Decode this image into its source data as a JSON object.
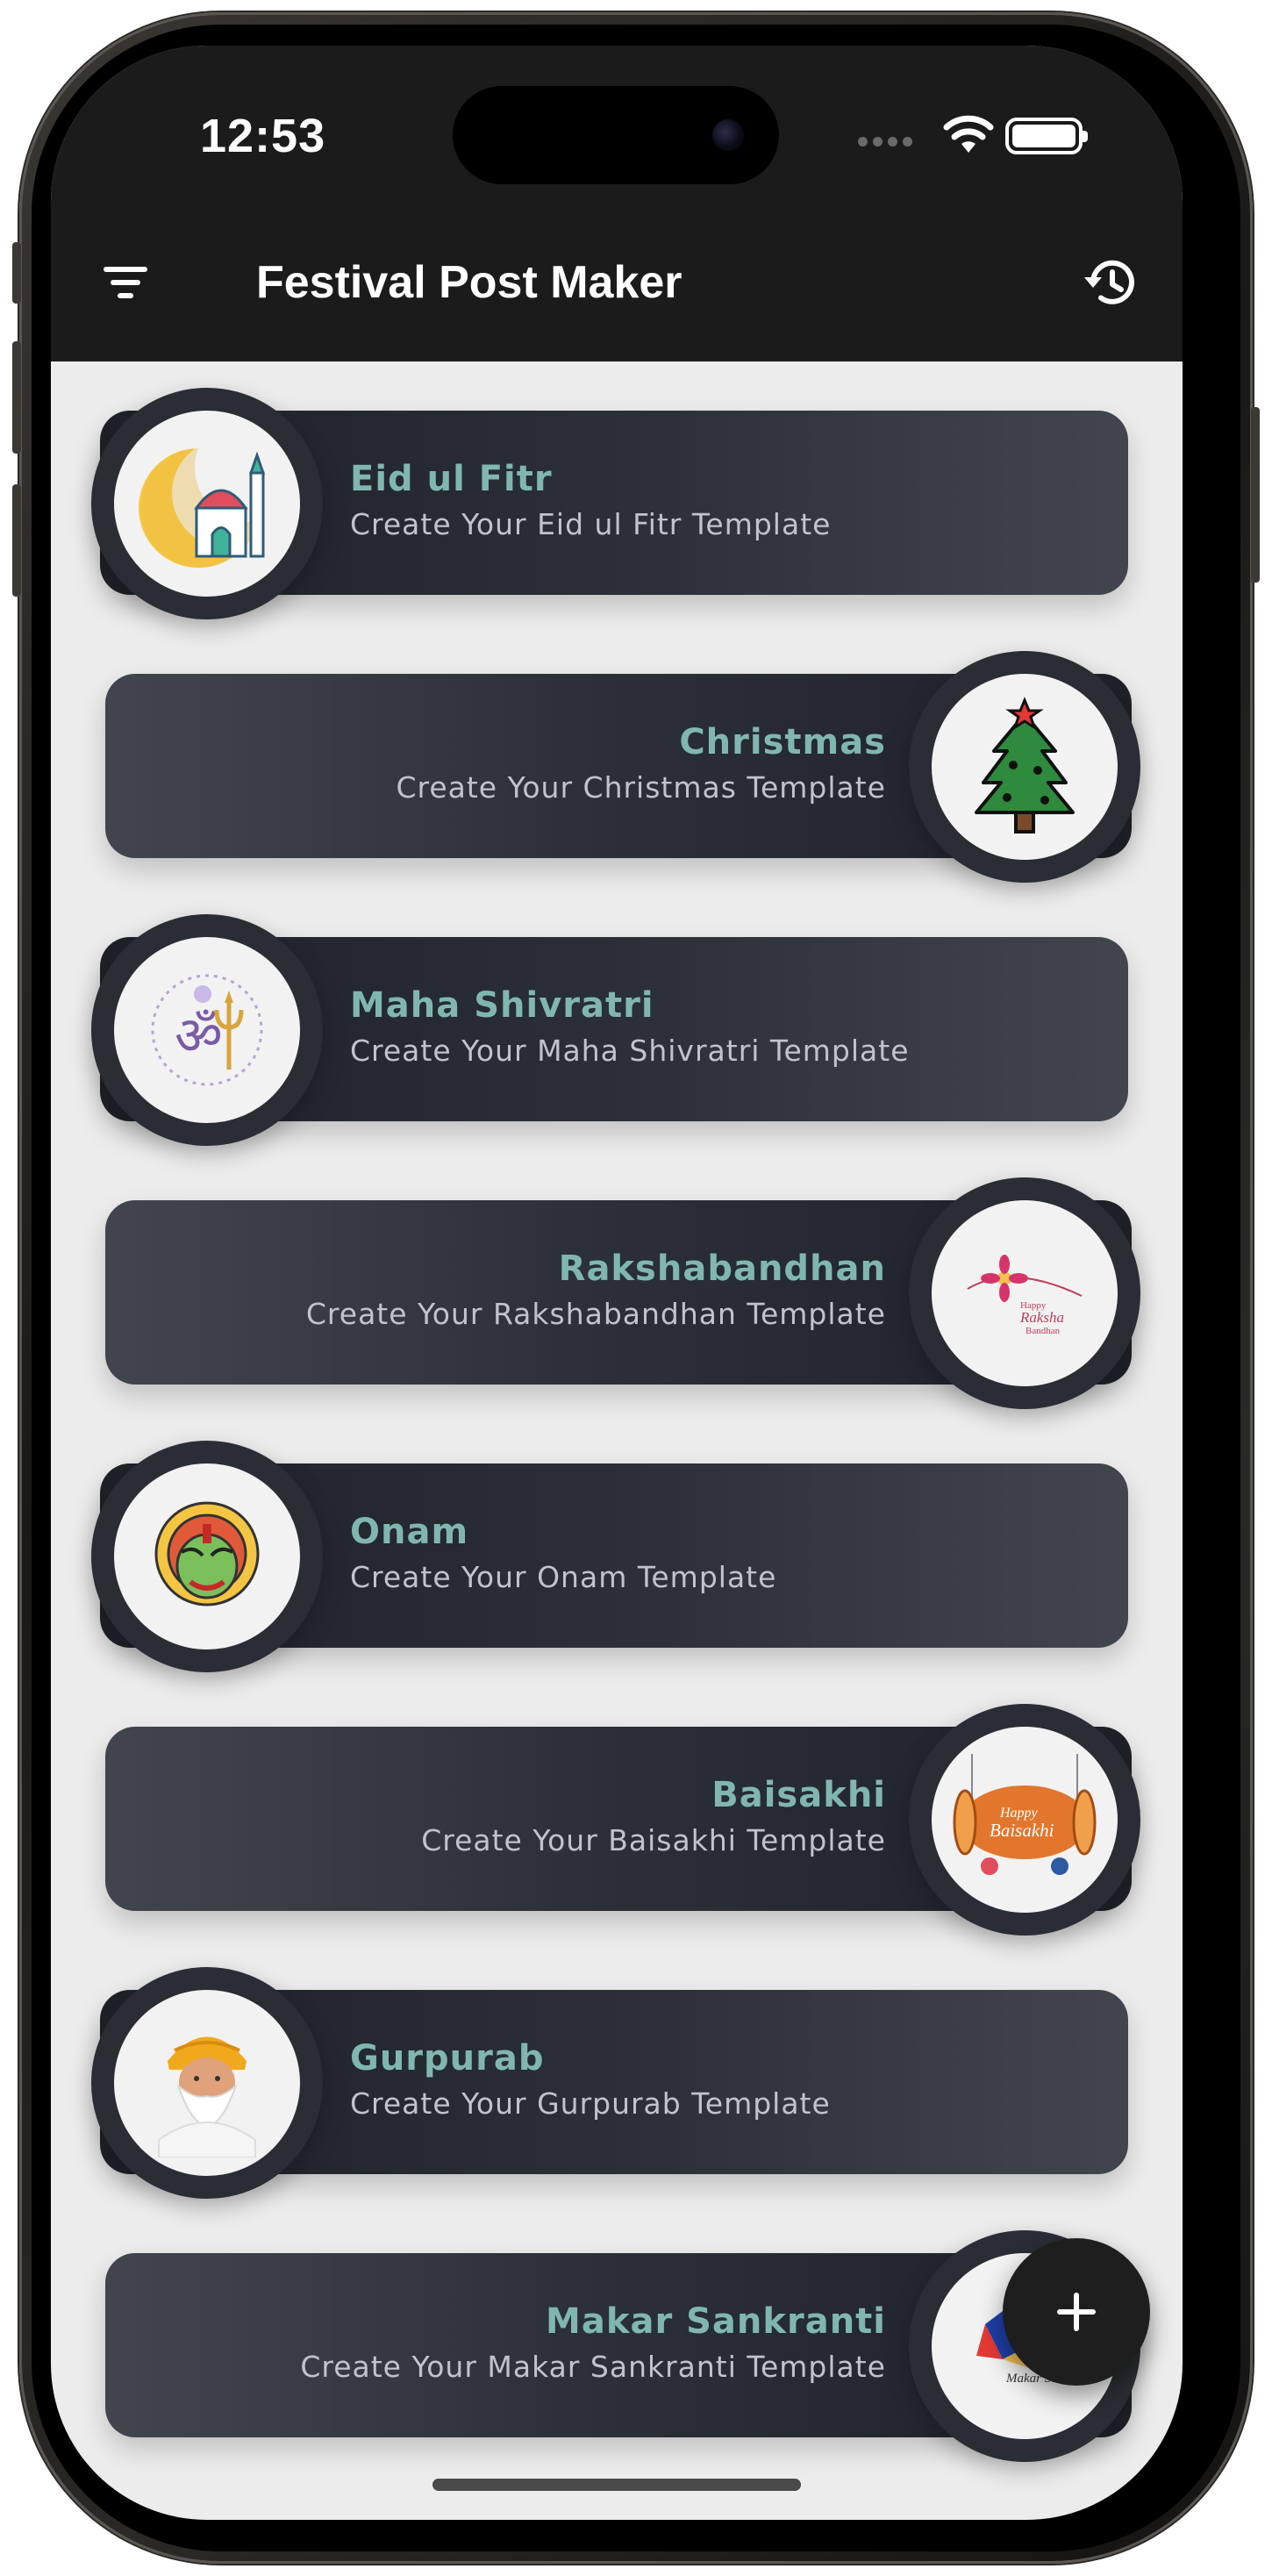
{
  "status_bar": {
    "time": "12:53"
  },
  "app_bar": {
    "title": "Festival Post Maker"
  },
  "festivals": [
    {
      "title": "Eid ul Fitr",
      "subtitle": "Create Your Eid ul Fitr Template",
      "icon": "crescent-mosque-icon"
    },
    {
      "title": "Christmas",
      "subtitle": "Create Your Christmas Template",
      "icon": "christmas-tree-icon"
    },
    {
      "title": "Maha Shivratri",
      "subtitle": "Create Your Maha Shivratri Template",
      "icon": "om-trident-icon"
    },
    {
      "title": "Rakshabandhan",
      "subtitle": "Create Your Rakshabandhan Template",
      "icon": "rakhi-icon",
      "badge_text": "Happy Raksha Bandhan"
    },
    {
      "title": "Onam",
      "subtitle": "Create Your Onam Template",
      "icon": "kathakali-face-icon"
    },
    {
      "title": "Baisakhi",
      "subtitle": "Create Your Baisakhi Template",
      "icon": "baisakhi-drum-icon",
      "badge_text": "Happy Baisakhi"
    },
    {
      "title": "Gurpurab",
      "subtitle": "Create Your Gurpurab Template",
      "icon": "sikh-elder-icon"
    },
    {
      "title": "Makar Sankranti",
      "subtitle": "Create Your Makar Sankranti Template",
      "icon": "kite-icon",
      "badge_text": "Makar Sankranti"
    }
  ],
  "colors": {
    "card_title": "#7fb7b0",
    "card_subtitle": "#bfc4c9",
    "card_dark": "#1e2127",
    "background": "#ececec",
    "app_bar": "#1b1b1b"
  }
}
